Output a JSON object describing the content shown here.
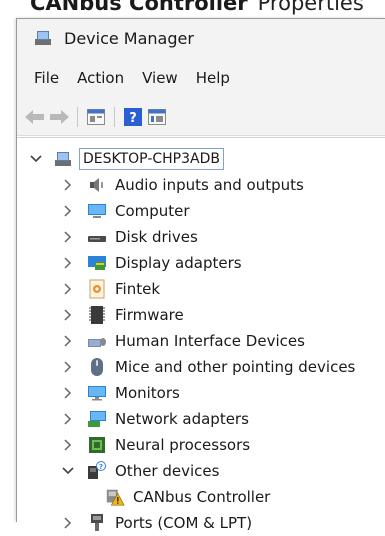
{
  "background_window": {
    "title_bold": "CANbus Controller",
    "title_rest": "Properties"
  },
  "window": {
    "title": "Device Manager"
  },
  "menu": [
    "File",
    "Action",
    "View",
    "Help"
  ],
  "toolbar": {
    "icons": [
      "back-arrow-icon",
      "forward-arrow-icon",
      "properties-icon",
      "help-icon",
      "show-hidden-icon"
    ]
  },
  "tree": {
    "root": "DESKTOP-CHP3ADB",
    "items": [
      "Audio inputs and outputs",
      "Computer",
      "Disk drives",
      "Display adapters",
      "Fintek",
      "Firmware",
      "Human Interface Devices",
      "Mice and other pointing devices",
      "Monitors",
      "Network adapters",
      "Neural processors",
      "Other devices",
      "CANbus Controller",
      "Ports (COM & LPT)"
    ]
  },
  "colors": {
    "accent": "#0067c0",
    "selection_border": "#7fa3d7",
    "warning": "#f2b51d"
  }
}
